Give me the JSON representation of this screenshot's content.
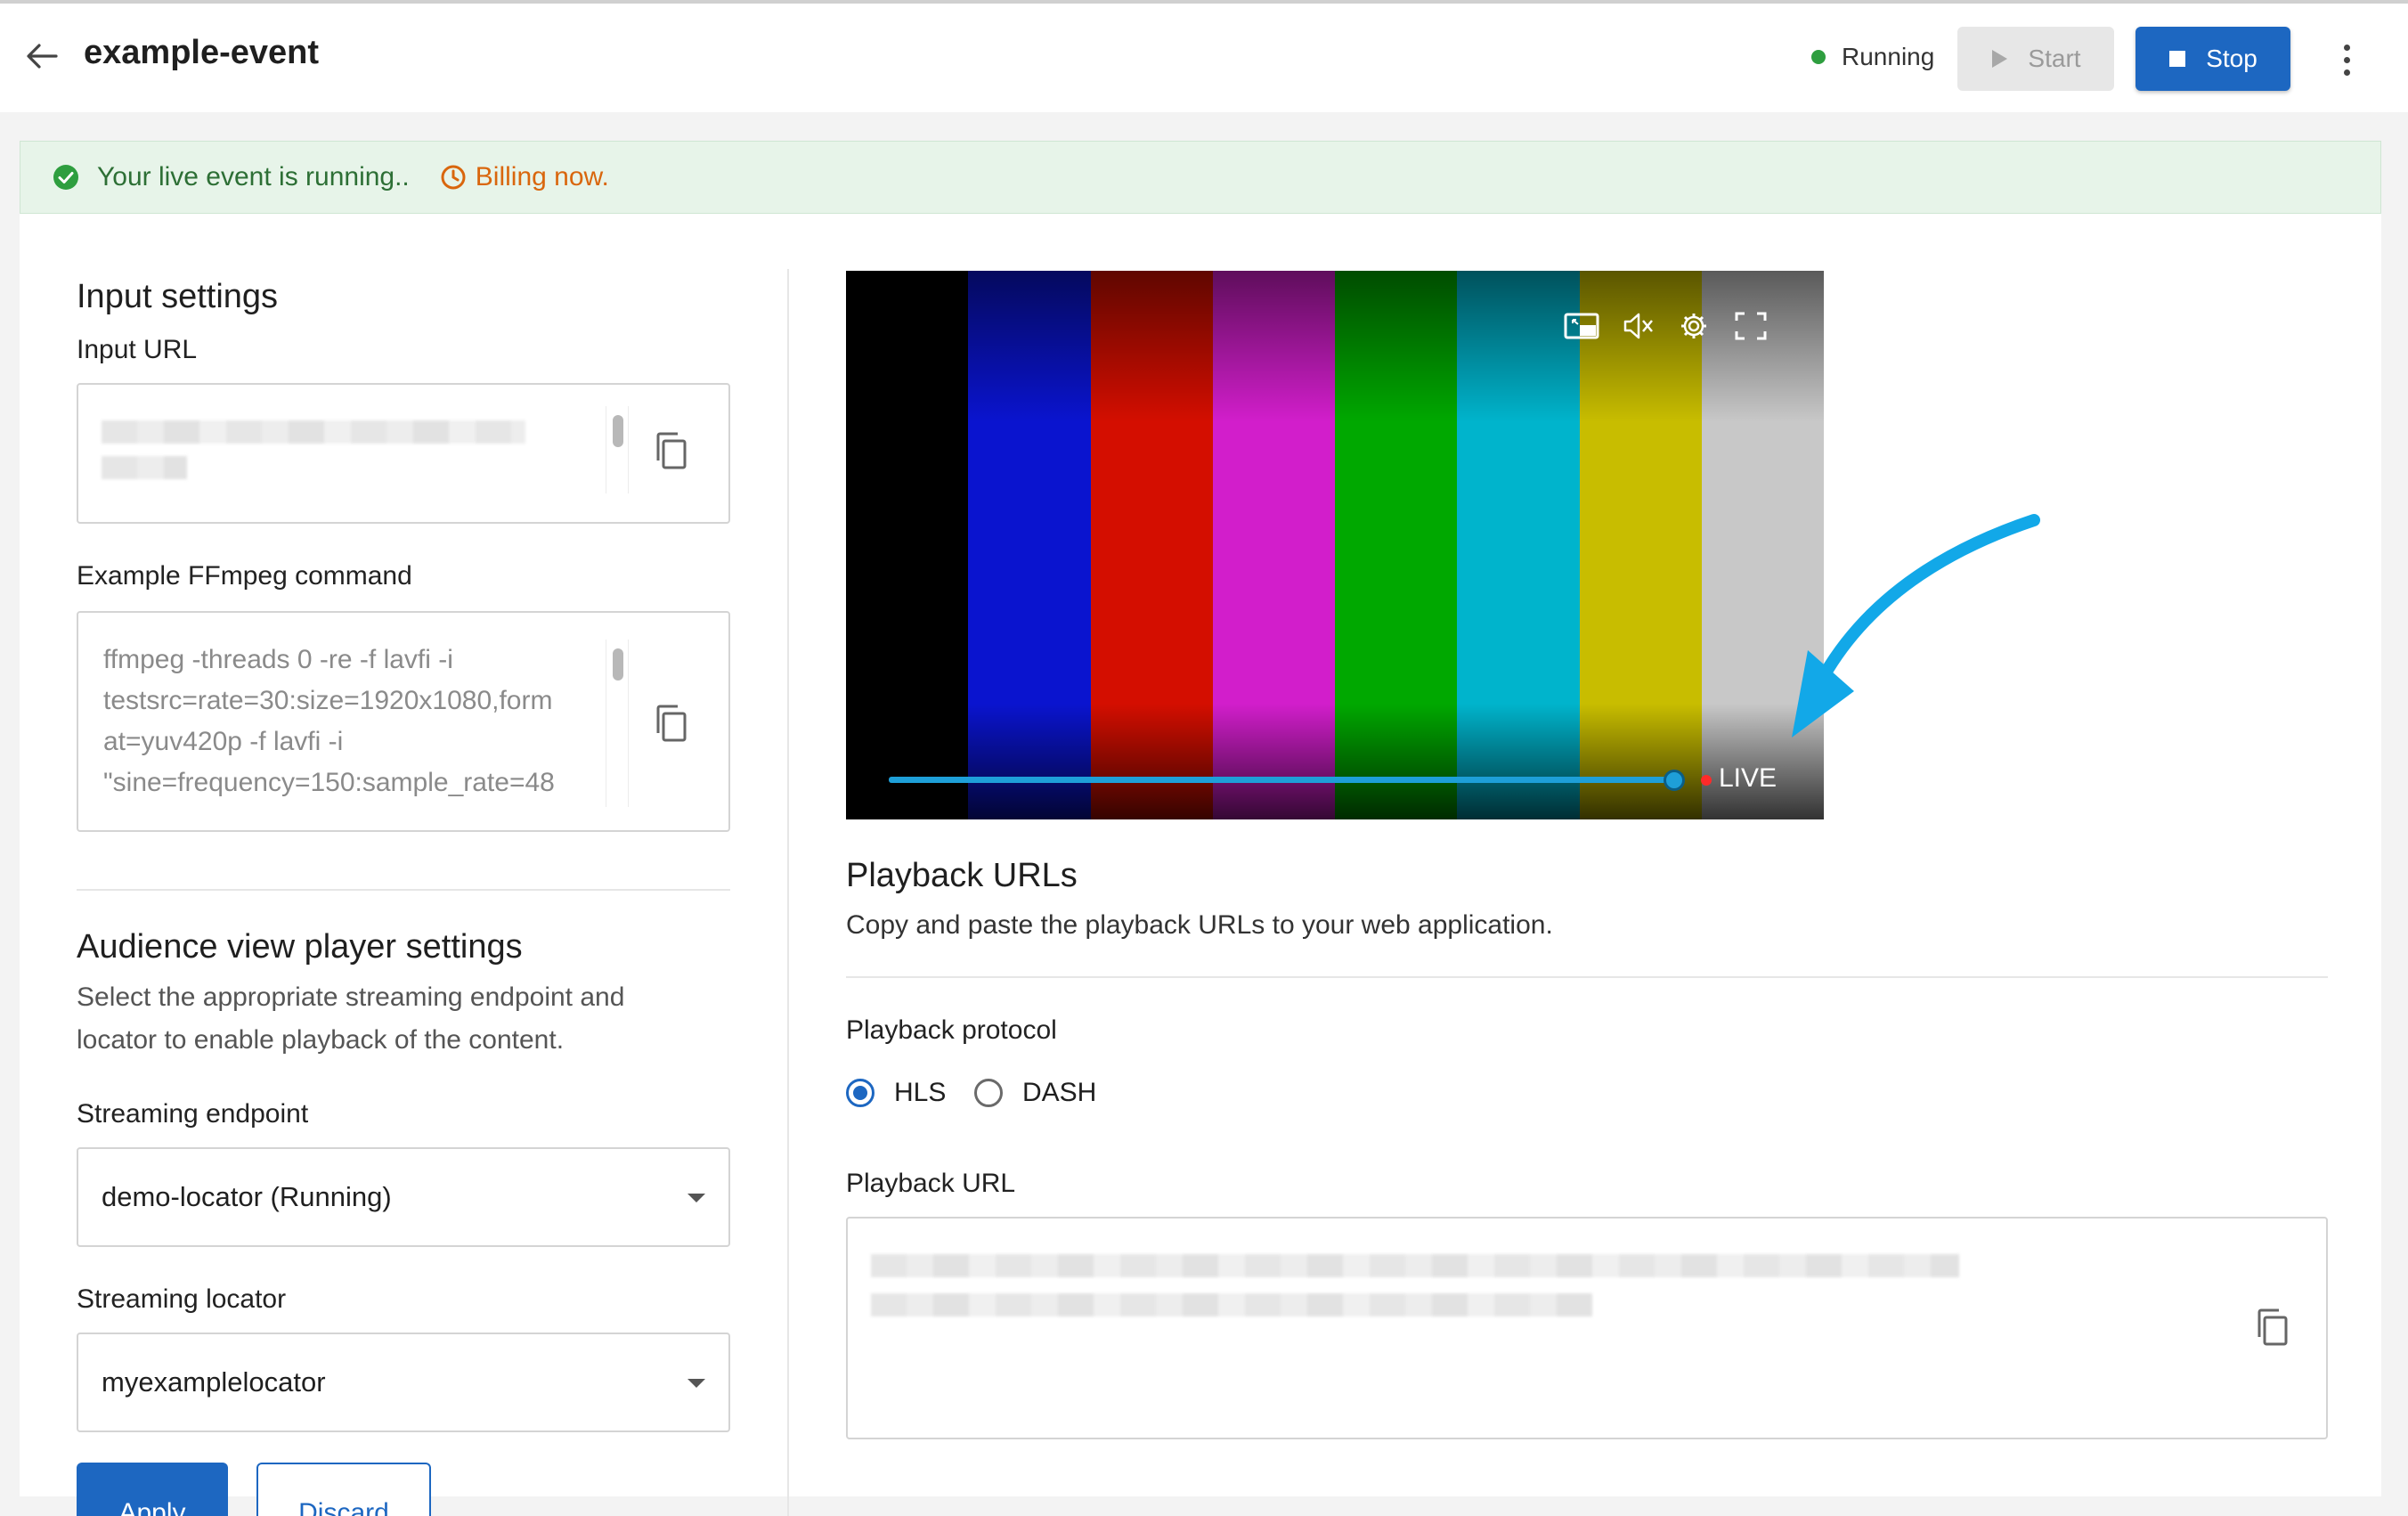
{
  "header": {
    "title": "example-event",
    "status": "Running",
    "start_label": "Start",
    "stop_label": "Stop"
  },
  "banner": {
    "running_text": "Your live event is running..",
    "billing_text": "Billing now."
  },
  "input_settings": {
    "heading": "Input settings",
    "input_url_label": "Input URL",
    "ffmpeg_label": "Example FFmpeg command",
    "ffmpeg_command": "ffmpeg -threads 0 -re -f lavfi -i\ntestsrc=rate=30:size=1920x1080,form\nat=yuv420p -f lavfi -i\n\"sine=frequency=150:sample_rate=48"
  },
  "audience": {
    "heading": "Audience view player settings",
    "description_line1": "Select the appropriate streaming endpoint and",
    "description_line2": "locator to enable playback of the content.",
    "endpoint_label": "Streaming endpoint",
    "endpoint_value": "demo-locator (Running)",
    "locator_label": "Streaming locator",
    "locator_value": "myexamplelocator",
    "apply_label": "Apply",
    "discard_label": "Discard"
  },
  "player": {
    "live_label": "LIVE",
    "color_bars": [
      "#c8c8c8",
      "#c8bd00",
      "#00b4cc",
      "#00a800",
      "#d21ecb",
      "#d40e00",
      "#0a14cf",
      "#000000"
    ],
    "arrow_color": "#12a8e8",
    "seek_color": "#1e9fd8",
    "icons": [
      "picture-in-picture-icon",
      "mute-icon",
      "settings-icon",
      "fullscreen-icon"
    ]
  },
  "playback": {
    "heading": "Playback URLs",
    "description": "Copy and paste the playback URLs to your web application.",
    "protocol_label": "Playback protocol",
    "protocols": [
      "HLS",
      "DASH"
    ],
    "selected_protocol": "HLS",
    "url_label": "Playback URL"
  },
  "colors": {
    "primary": "#1d67c1",
    "success": "#2e9e3f",
    "banner_bg": "#e7f4e9",
    "billing": "#d9660d"
  }
}
